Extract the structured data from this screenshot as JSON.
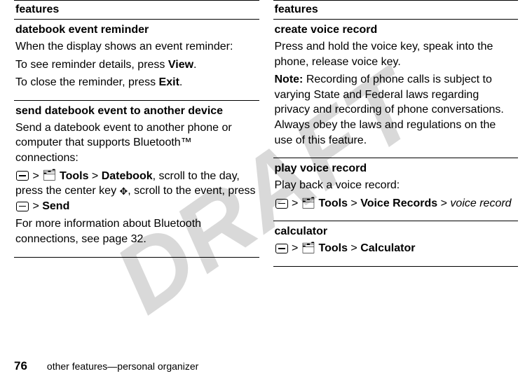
{
  "watermark": "DRAFT",
  "left_column": {
    "header": "features",
    "cells": [
      {
        "title": "datebook event reminder",
        "lines": [
          {
            "text": "When the display shows an event reminder:"
          },
          {
            "parts": [
              "To see reminder details, press ",
              {
                "narrow": "View"
              },
              "."
            ]
          },
          {
            "parts": [
              "To close the reminder, press ",
              {
                "narrow": "Exit"
              },
              "."
            ]
          }
        ]
      },
      {
        "title": "send datebook event to another device",
        "lines": [
          {
            "text": "Send a datebook event to another phone or computer that supports Bluetooth™ connections:"
          },
          {
            "parts": [
              {
                "icon": "menu"
              },
              " > ",
              {
                "icon": "tools"
              },
              " ",
              {
                "narrow": "Tools"
              },
              " > ",
              {
                "narrow": "Datebook"
              },
              ", scroll to the day, press the center key ",
              {
                "icon": "center"
              },
              ", scroll to the event, press ",
              {
                "icon": "menu"
              },
              " > ",
              {
                "narrow": "Send"
              }
            ]
          },
          {
            "text": "For more information about Bluetooth connections, see page 32."
          }
        ]
      }
    ]
  },
  "right_column": {
    "header": "features",
    "cells": [
      {
        "title": "create voice record",
        "lines": [
          {
            "text": "Press and hold the voice key, speak into the phone, release voice key."
          },
          {
            "parts": [
              {
                "bold": "Note:"
              },
              " Recording of phone calls is subject to varying State and Federal laws regarding privacy and recording of phone conversations. Always obey the laws and regulations on the use of this feature."
            ]
          }
        ]
      },
      {
        "title": "play voice record",
        "lines": [
          {
            "text": "Play back a voice record:"
          },
          {
            "parts": [
              {
                "icon": "menu"
              },
              " > ",
              {
                "icon": "tools"
              },
              " ",
              {
                "narrow": "Tools"
              },
              " > ",
              {
                "narrow": "Voice Records"
              },
              " > ",
              {
                "italic": "voice record"
              }
            ]
          }
        ]
      },
      {
        "title": "calculator",
        "lines": [
          {
            "parts": [
              {
                "icon": "menu"
              },
              " > ",
              {
                "icon": "tools"
              },
              " ",
              {
                "narrow": "Tools"
              },
              " > ",
              {
                "narrow": "Calculator"
              }
            ]
          }
        ]
      }
    ]
  },
  "footer": {
    "page": "76",
    "text": "other features—personal organizer"
  }
}
